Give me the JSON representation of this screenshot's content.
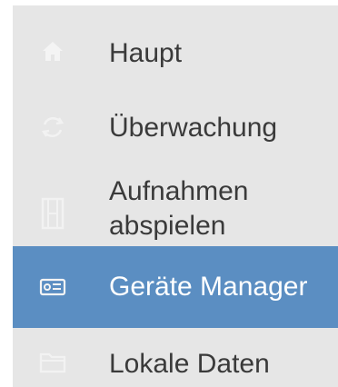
{
  "menu": {
    "items": [
      {
        "label": "Haupt",
        "icon": "home-icon",
        "selected": false
      },
      {
        "label": "Überwachung",
        "icon": "sync-camera-icon",
        "selected": false
      },
      {
        "label": "Aufnahmen\nabspielen",
        "icon": "film-icon",
        "selected": false
      },
      {
        "label": "Geräte Manager",
        "icon": "device-recorder-icon",
        "selected": true
      },
      {
        "label": "Lokale Daten",
        "icon": "folder-icon",
        "selected": false
      }
    ]
  },
  "colors": {
    "menu_background": "#e6e6e6",
    "selected_background": "#5b8ec2",
    "label_text": "#3a3a3a",
    "selected_text": "#ffffff",
    "icon_color": "#f0f0f0"
  }
}
